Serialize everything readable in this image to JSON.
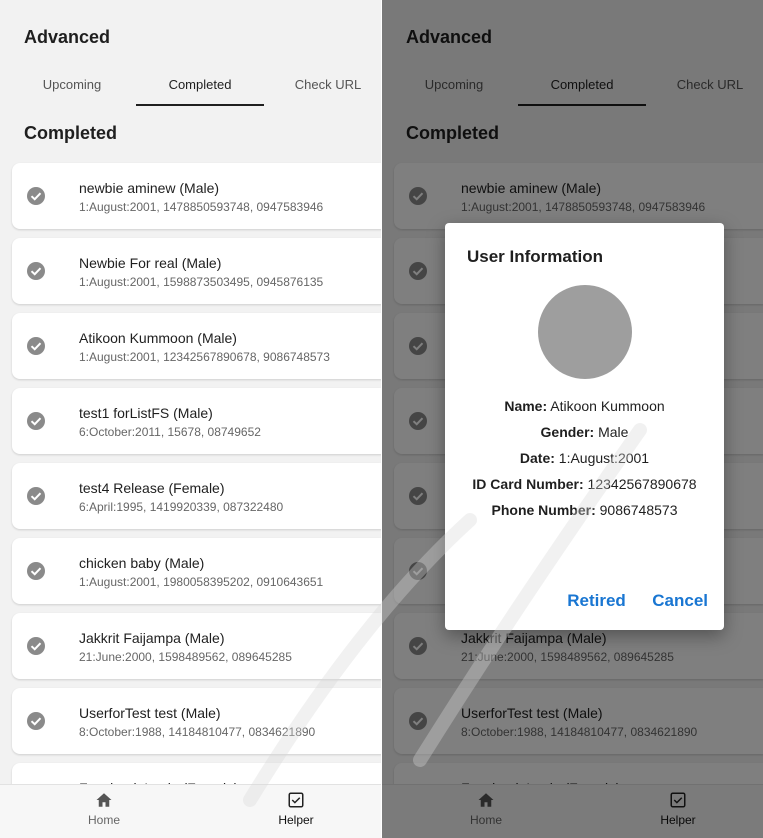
{
  "app": {
    "title": "Advanced"
  },
  "tabs": [
    {
      "label": "Upcoming"
    },
    {
      "label": "Completed"
    },
    {
      "label": "Check URL"
    }
  ],
  "active_tab": "Completed",
  "section_title": "Completed",
  "users": [
    {
      "name": "newbie aminew (Male)",
      "detail": "1:August:2001, 1478850593748, 0947583946"
    },
    {
      "name": "Newbie For real (Male)",
      "detail": "1:August:2001, 1598873503495, 0945876135"
    },
    {
      "name": "Atikoon Kummoon (Male)",
      "detail": "1:August:2001, 12342567890678, 9086748573"
    },
    {
      "name": "test1 forListFS (Male)",
      "detail": "6:October:2011, 15678, 08749652"
    },
    {
      "name": "test4 Release  (Female)",
      "detail": "6:April:1995, 1419920339, 087322480"
    },
    {
      "name": "chicken baby (Male)",
      "detail": "1:August:2001, 1980058395202, 0910643651"
    },
    {
      "name": "Jakkrit Faijampa (Male)",
      "detail": "21:June:2000, 1598489562, 089645285"
    },
    {
      "name": "UserforTest test (Male)",
      "detail": "8:October:1988, 14184810477, 0834621890"
    },
    {
      "name": "Facebook Login (Female)",
      "detail": ""
    }
  ],
  "bottom_nav": [
    {
      "label": "Home",
      "icon": "home-icon"
    },
    {
      "label": "Helper",
      "icon": "checkbox-icon"
    }
  ],
  "dialog": {
    "title": "User Information",
    "fields": [
      {
        "label": "Name:",
        "value": "Atikoon Kummoon"
      },
      {
        "label": "Gender:",
        "value": "Male"
      },
      {
        "label": "Date:",
        "value": "1:August:2001"
      },
      {
        "label": "ID Card Number:",
        "value": "12342567890678"
      },
      {
        "label": "Phone Number:",
        "value": "9086748573"
      }
    ],
    "retired_label": "Retired",
    "cancel_label": "Cancel"
  },
  "colors": {
    "accent": "#1976d2",
    "check_icon": "#8a8a8a",
    "avatar": "#9e9e9e"
  }
}
